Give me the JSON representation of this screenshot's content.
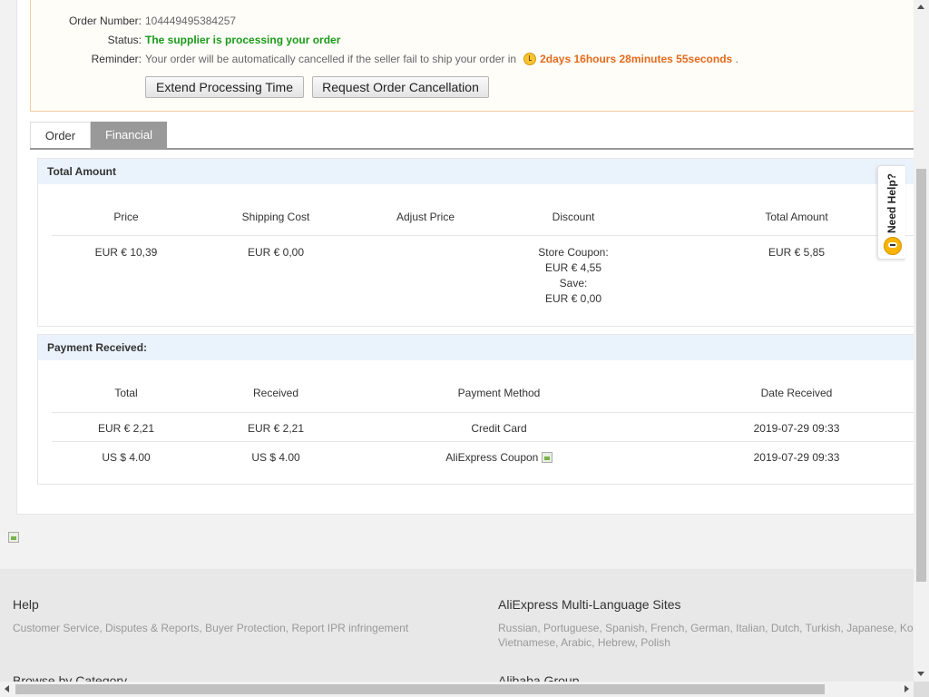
{
  "order": {
    "number_label": "Order Number:",
    "number_value": "104449495384257",
    "status_label": "Status:",
    "status_value": "The supplier is processing your order",
    "reminder_label": "Reminder:",
    "reminder_text": "Your order will be automatically cancelled if the seller fail to ship your order in",
    "reminder_time": "2days 16hours 28minutes 55seconds",
    "reminder_end": ".",
    "extend_button": "Extend Processing Time",
    "cancel_button": "Request Order Cancellation"
  },
  "tabs": [
    {
      "label": "Order"
    },
    {
      "label": "Financial"
    }
  ],
  "total_amount": {
    "title": "Total Amount",
    "headers": [
      "Price",
      "Shipping Cost",
      "Adjust Price",
      "Discount",
      "Total Amount"
    ],
    "row": {
      "price": "EUR € 10,39",
      "shipping": "EUR € 0,00",
      "adjust": "",
      "discount_line1": "Store Coupon:",
      "discount_line2": "EUR € 4,55",
      "discount_line3": "Save:",
      "discount_line4": "EUR € 0,00",
      "total": "EUR € 5,85"
    }
  },
  "payment": {
    "title": "Payment Received:",
    "headers": [
      "Total",
      "Received",
      "Payment Method",
      "Date Received"
    ],
    "rows": [
      {
        "total": "EUR € 2,21",
        "received": "EUR € 2,21",
        "method": "Credit Card",
        "date": "2019-07-29 09:33"
      },
      {
        "total": "US $ 4.00",
        "received": "US $ 4.00",
        "method": "AliExpress Coupon",
        "date": "2019-07-29 09:33"
      }
    ]
  },
  "need_help": "Need Help?",
  "footer": {
    "help_title": "Help",
    "help_links": "Customer Service, Disputes & Reports, Buyer Protection, Report IPR infringement",
    "lang_title": "AliExpress Multi-Language Sites",
    "lang_links_1": "Russian, Portuguese, Spanish, French, German, Italian, Dutch, Turkish, Japanese, Korean, Thai,",
    "lang_links_2": "Vietnamese, Arabic, Hebrew, Polish",
    "browse_title": "Browse by Category",
    "alibaba_title": "Alibaba Group"
  }
}
